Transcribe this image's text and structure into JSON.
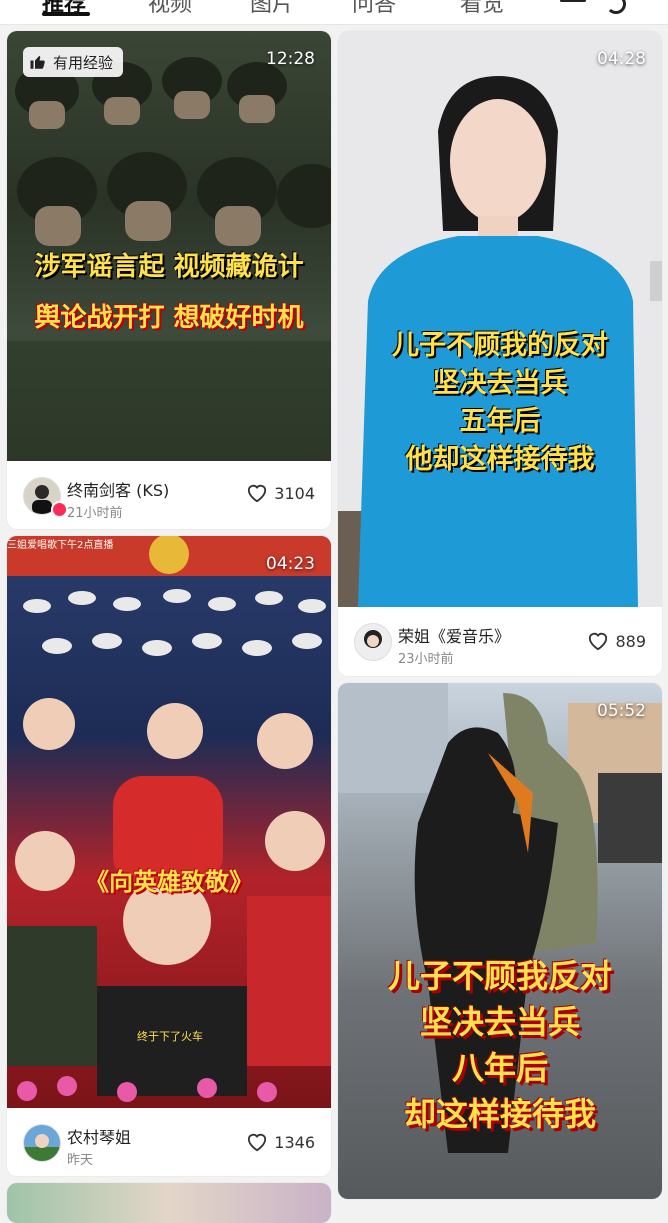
{
  "tabs": [
    {
      "label": "推荐",
      "active": true
    },
    {
      "label": "视频"
    },
    {
      "label": "图片"
    },
    {
      "label": "问答"
    },
    {
      "label": "看览"
    }
  ],
  "cards": [
    {
      "duration": "12:28",
      "badge": "有用经验",
      "caption_line1": "涉军谣言起  视频藏诡计",
      "caption_line2": "舆论战开打  想破好时机",
      "author": "终南剑客 (KS)",
      "time": "21小时前",
      "likes": "3104"
    },
    {
      "duration": "04:28",
      "caption_lines": [
        "儿子不顾我的反对",
        "坚决去当兵",
        "五年后",
        "他却这样接待我"
      ],
      "author": "荣姐《爱音乐》",
      "time": "23小时前",
      "likes": "889"
    },
    {
      "duration": "04:23",
      "top_strip": "三姐爱唱歌下午2点直播",
      "caption": "《向英雄致敬》",
      "small_text": "终于下了火车",
      "author": "农村琴姐",
      "time": "昨天",
      "likes": "1346"
    },
    {
      "duration": "05:52",
      "caption_lines": [
        "儿子不顾我反对",
        "坚决去当兵",
        "八年后",
        "却这样接待我"
      ]
    }
  ],
  "colors": {
    "accent": "#fe2c55",
    "caption_yellow": "#ffe14a",
    "caption_blue_bg": "#2a9fd8"
  }
}
